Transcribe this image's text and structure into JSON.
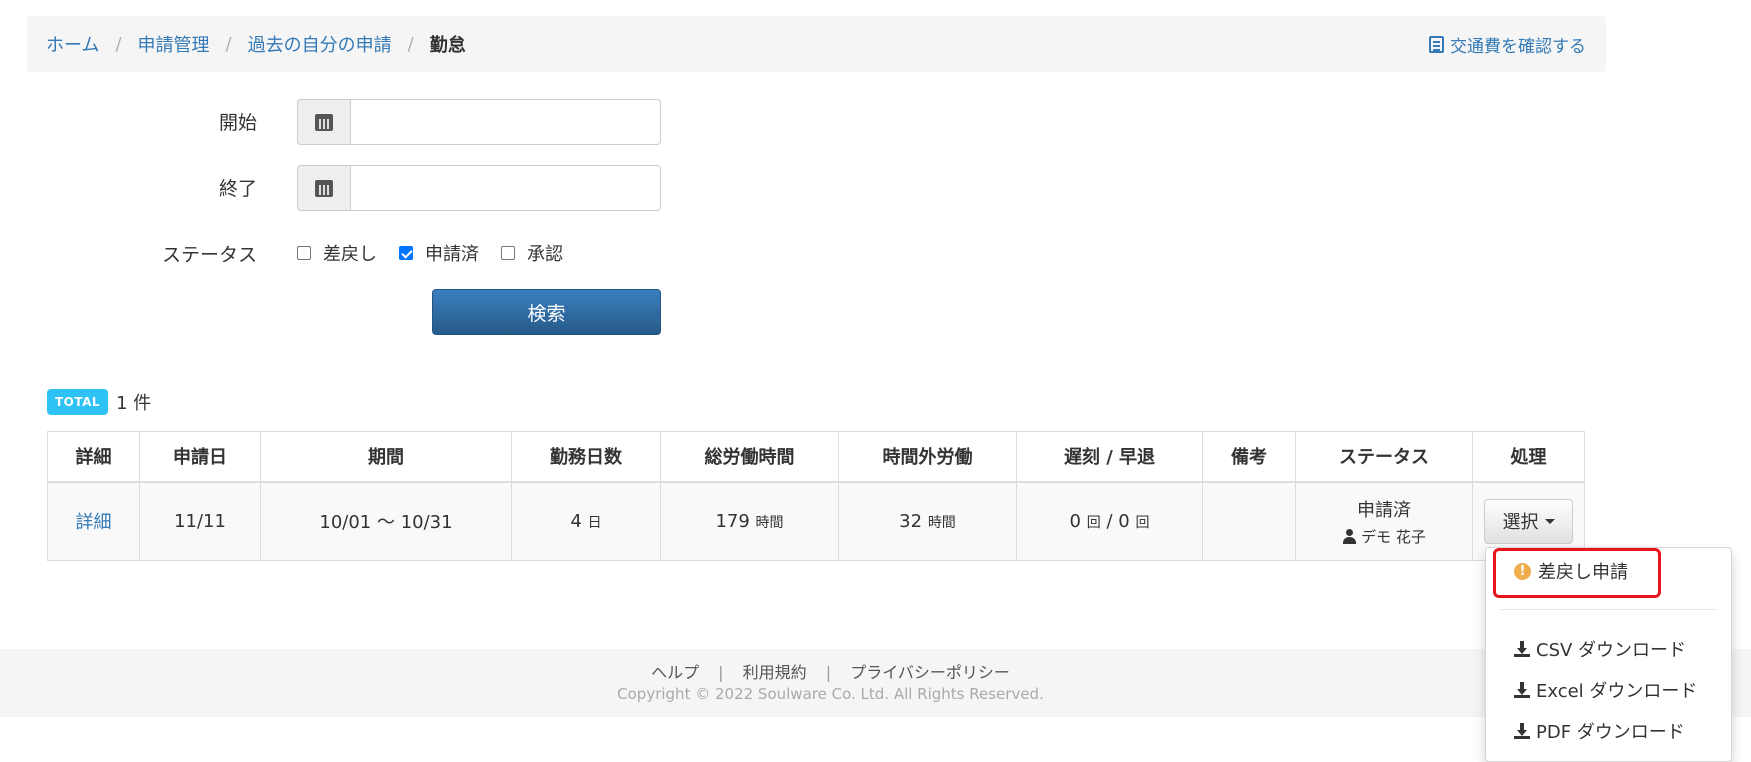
{
  "breadcrumb": {
    "items": [
      "ホーム",
      "申請管理",
      "過去の自分の申請"
    ],
    "separator": "/",
    "active": "勤怠",
    "right_link": "交通費を確認する"
  },
  "form": {
    "start_label": "開始",
    "start_value": "",
    "end_label": "終了",
    "end_value": "",
    "status_label": "ステータス",
    "status_options": [
      {
        "label": "差戻し",
        "checked": false
      },
      {
        "label": "申請済",
        "checked": true
      },
      {
        "label": "承認",
        "checked": false
      }
    ],
    "search_button": "検索"
  },
  "total": {
    "badge": "TOTAL",
    "count": "1 件"
  },
  "table": {
    "headers": [
      "詳細",
      "申請日",
      "期間",
      "勤務日数",
      "総労働時間",
      "時間外労働",
      "遅刻 / 早退",
      "備考",
      "ステータス",
      "処理"
    ],
    "row": {
      "detail_link": "詳細",
      "date": "11/11",
      "period": "10/01 ～ 10/31",
      "days": "4",
      "days_unit": "日",
      "total_hours": "179",
      "total_hours_unit": "時間",
      "overtime": "32",
      "overtime_unit": "時間",
      "late": "0",
      "late_unit": "回",
      "late_sep": "/",
      "early": "0",
      "early_unit": "回",
      "note": "",
      "status": "申請済",
      "user": "デモ 花子",
      "action_button": "選択"
    }
  },
  "dropdown": {
    "items": [
      {
        "label": "差戻し申請",
        "icon": "warning-icon"
      },
      {
        "label": "CSV ダウンロード",
        "icon": "download-icon"
      },
      {
        "label": "Excel ダウンロード",
        "icon": "download-icon"
      },
      {
        "label": "PDF ダウンロード",
        "icon": "download-icon"
      }
    ]
  },
  "footer": {
    "links": [
      "ヘルプ",
      "利用規約",
      "プライバシーポリシー"
    ],
    "separator": "|",
    "copyright": "Copyright © 2022 Soulware Co. Ltd. All Rights Reserved."
  },
  "colors": {
    "link": "#337ab7",
    "primary_button": "#2e6da4",
    "total_badge": "#2fc3f5",
    "warning": "#f0ad4e",
    "highlight": "#e8141b"
  }
}
